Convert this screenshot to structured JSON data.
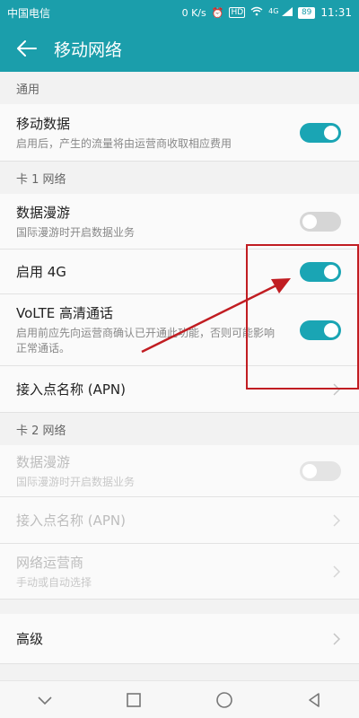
{
  "status_bar": {
    "carrier": "中国电信",
    "speed": "0 K/s",
    "hd_badge": "HD",
    "signal_label": "4G",
    "battery": "89",
    "time": "11:31",
    "icons": [
      "alarm-icon",
      "wifi-icon",
      "signal-icon",
      "battery-icon"
    ]
  },
  "app_bar": {
    "title": "移动网络",
    "back_icon": "arrow-left-icon"
  },
  "sections": {
    "general": {
      "header": "通用",
      "mobile_data": {
        "title": "移动数据",
        "subtitle": "启用后，产生的流量将由运营商收取相应费用",
        "enabled": true
      }
    },
    "sim1": {
      "header": "卡 1 网络",
      "data_roaming": {
        "title": "数据漫游",
        "subtitle": "国际漫游时开启数据业务",
        "enabled": false
      },
      "enable_4g": {
        "title": "启用 4G",
        "enabled": true
      },
      "volte": {
        "title": "VoLTE 高清通话",
        "subtitle": "启用前应先向运营商确认已开通此功能，否则可能影响正常通话。",
        "enabled": true
      },
      "apn": {
        "title": "接入点名称 (APN)"
      }
    },
    "sim2": {
      "header": "卡 2 网络",
      "data_roaming": {
        "title": "数据漫游",
        "subtitle": "国际漫游时开启数据业务",
        "enabled": false
      },
      "apn": {
        "title": "接入点名称 (APN)"
      },
      "operator": {
        "title": "网络运营商",
        "subtitle": "手动或自动选择"
      }
    },
    "advanced": {
      "title": "高级"
    }
  },
  "nav_bar": {
    "icons": [
      "nav-collapse-icon",
      "nav-recent-icon",
      "nav-home-icon",
      "nav-back-icon"
    ]
  },
  "colors": {
    "accent": "#1b9eab",
    "annotation": "#c11d22"
  }
}
